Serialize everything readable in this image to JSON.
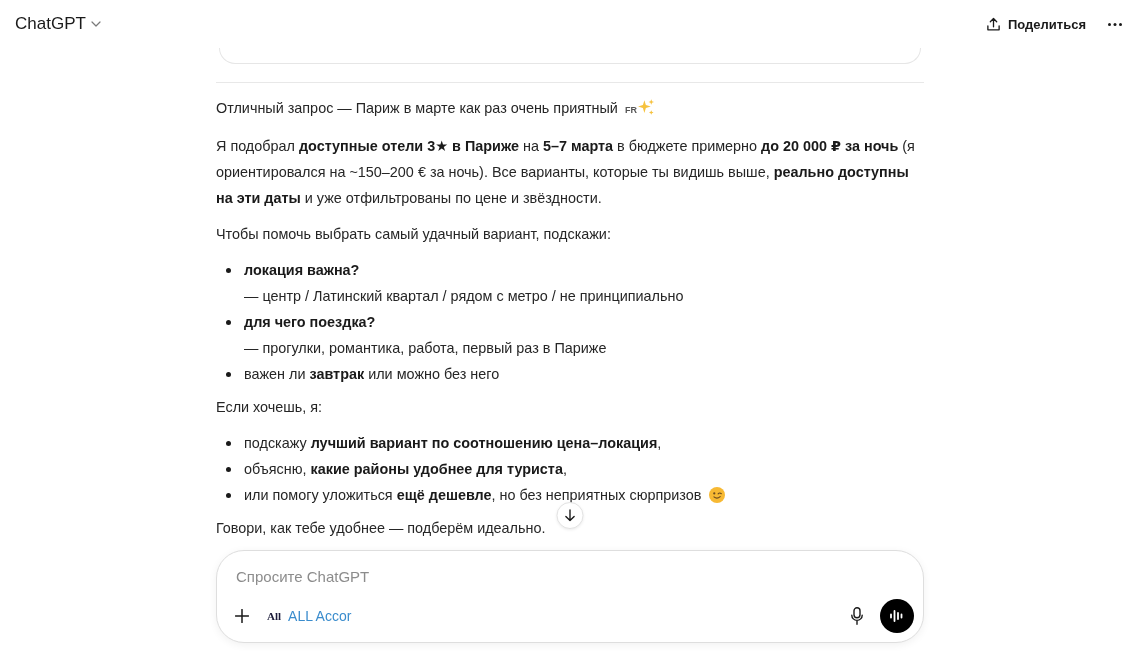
{
  "header": {
    "title": "ChatGPT",
    "share_label": "Поделиться"
  },
  "message": {
    "blocks": [
      {
        "kind": "intro",
        "text": "Отличный запрос — Париж в марте как раз очень приятный",
        "flag": "FR"
      },
      {
        "kind": "paragraph",
        "text": "Я подобрал **доступные отели 3★ в Париже** на **5–7 марта** в бюджете примерно **до 20 000 ₽ за ночь** (я ориентировался на ~150–200 € за ночь). Все варианты, которые ты видишь выше, **реально доступны на эти даты** и уже отфильтрованы по цене и звёздности."
      },
      {
        "kind": "paragraph",
        "text": "Чтобы помочь выбрать самый удачный вариант, подскажи:"
      },
      {
        "kind": "list",
        "items": [
          {
            "kind": "question",
            "text": "**локация важна?**",
            "note": "— центр / Латинский квартал / рядом с метро / не принципиально"
          },
          {
            "kind": "question",
            "text": "**для чего поездка?**",
            "note": "— прогулки, романтика, работа, первый раз в Париже"
          },
          {
            "kind": "plain",
            "text": "важен ли **завтрак** или можно без него"
          }
        ]
      },
      {
        "kind": "paragraph",
        "text": "Если хочешь, я:"
      },
      {
        "kind": "list",
        "items": [
          {
            "kind": "plain",
            "text": "подскажу **лучший вариант по соотношению цена–локация**,"
          },
          {
            "kind": "plain",
            "text": "объясню, **какие районы удобнее для туриста**,"
          },
          {
            "kind": "emoji",
            "text": "или помогу уложиться **ещё дешевле**, но без неприятных сюрпризов"
          }
        ]
      },
      {
        "kind": "paragraph",
        "text": "Говори, как тебе удобнее — подберём идеально."
      }
    ]
  },
  "composer": {
    "placeholder": "Спросите ChatGPT",
    "app": {
      "logo": "All",
      "label": "ALL Accor"
    }
  }
}
